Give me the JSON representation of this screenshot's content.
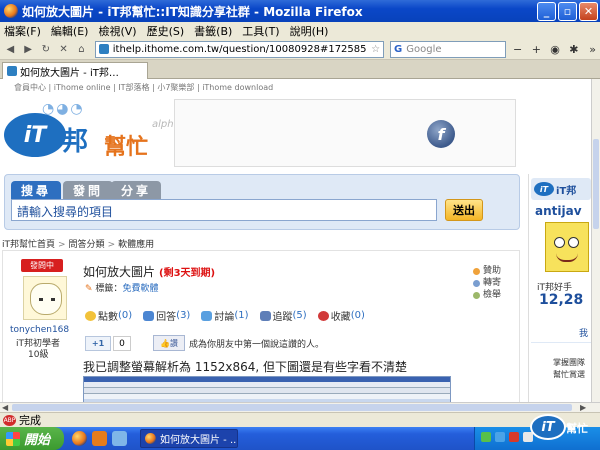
{
  "window": {
    "title": "如何放大圖片 - iT邦幫忙::IT知識分享社群 - Mozilla Firefox"
  },
  "menu": [
    "檔案(F)",
    "編輯(E)",
    "檢視(V)",
    "歷史(S)",
    "書籤(B)",
    "工具(T)",
    "說明(H)"
  ],
  "nav": {
    "url": "ithelp.ithome.com.tw/question/10080928#172585",
    "search_placeholder": "Google"
  },
  "tab": {
    "label": "如何放大圖片 - iT邦…"
  },
  "page": {
    "toplinks": "會員中心 | iThome online | IT部落格 | 小7聚樂部 | iThome download",
    "logo": {
      "it": "iT",
      "bang": "邦",
      "help": "幫忙",
      "alpha": "alpha"
    },
    "search": {
      "tabs": [
        "搜尋",
        "發問",
        "分享"
      ],
      "placeholder": "請輸入搜尋的項目",
      "button": "送出"
    },
    "breadcrumb": [
      "iT邦幫忙首頁",
      "問答分類",
      "軟體應用"
    ],
    "question": {
      "badge": "發問中",
      "title": "如何放大圖片",
      "days_left": "(剩3天到期)",
      "tags_label": "標籤：",
      "tag": "免費軟體",
      "actions": [
        "贊助",
        "轉寄",
        "檢舉"
      ],
      "stats": [
        {
          "label": "點數",
          "value": "(0)"
        },
        {
          "label": "回答",
          "value": "(3)"
        },
        {
          "label": "討論",
          "value": "(1)"
        },
        {
          "label": "追蹤",
          "value": "(5)"
        },
        {
          "label": "收藏",
          "value": "(0)"
        }
      ],
      "plusone": "+1",
      "plusone_count": "0",
      "like": "讚",
      "like_text": "成為你朋友中第一個說這讚的人。",
      "body": "我已調整螢幕解析為 1152x864, 但下圖還是有些字看不清楚",
      "user": {
        "name": "tonychen168",
        "title": "iT邦初學者",
        "level": "10級"
      }
    },
    "right": {
      "header": "iT邦",
      "user": "antijav",
      "caption": "iT邦好手",
      "number": "12,28",
      "more": "我",
      "texts": [
        "掌握團隊",
        "幫忙賞選"
      ]
    }
  },
  "status": {
    "text": "完成"
  },
  "taskbar": {
    "start": "開始",
    "item": "如何放大圖片 - ..."
  },
  "tray_logo": {
    "it": "iT",
    "text": "幫忙"
  }
}
